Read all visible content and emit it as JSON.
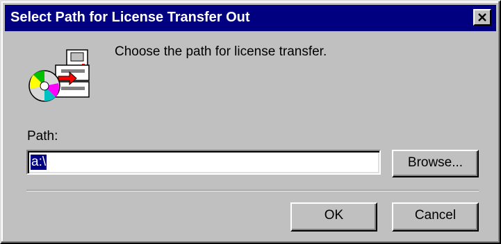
{
  "window": {
    "title": "Select Path for License Transfer Out",
    "close_icon": "close-icon"
  },
  "content": {
    "icon": "disk-transfer-icon",
    "prompt": "Choose the path for license transfer.",
    "path_label": "Path:",
    "path_value": "a:\\"
  },
  "buttons": {
    "browse": "Browse...",
    "ok": "OK",
    "cancel": "Cancel"
  },
  "colors": {
    "titlebar": "#000080",
    "face": "#c0c0c0",
    "selection": "#000080"
  }
}
